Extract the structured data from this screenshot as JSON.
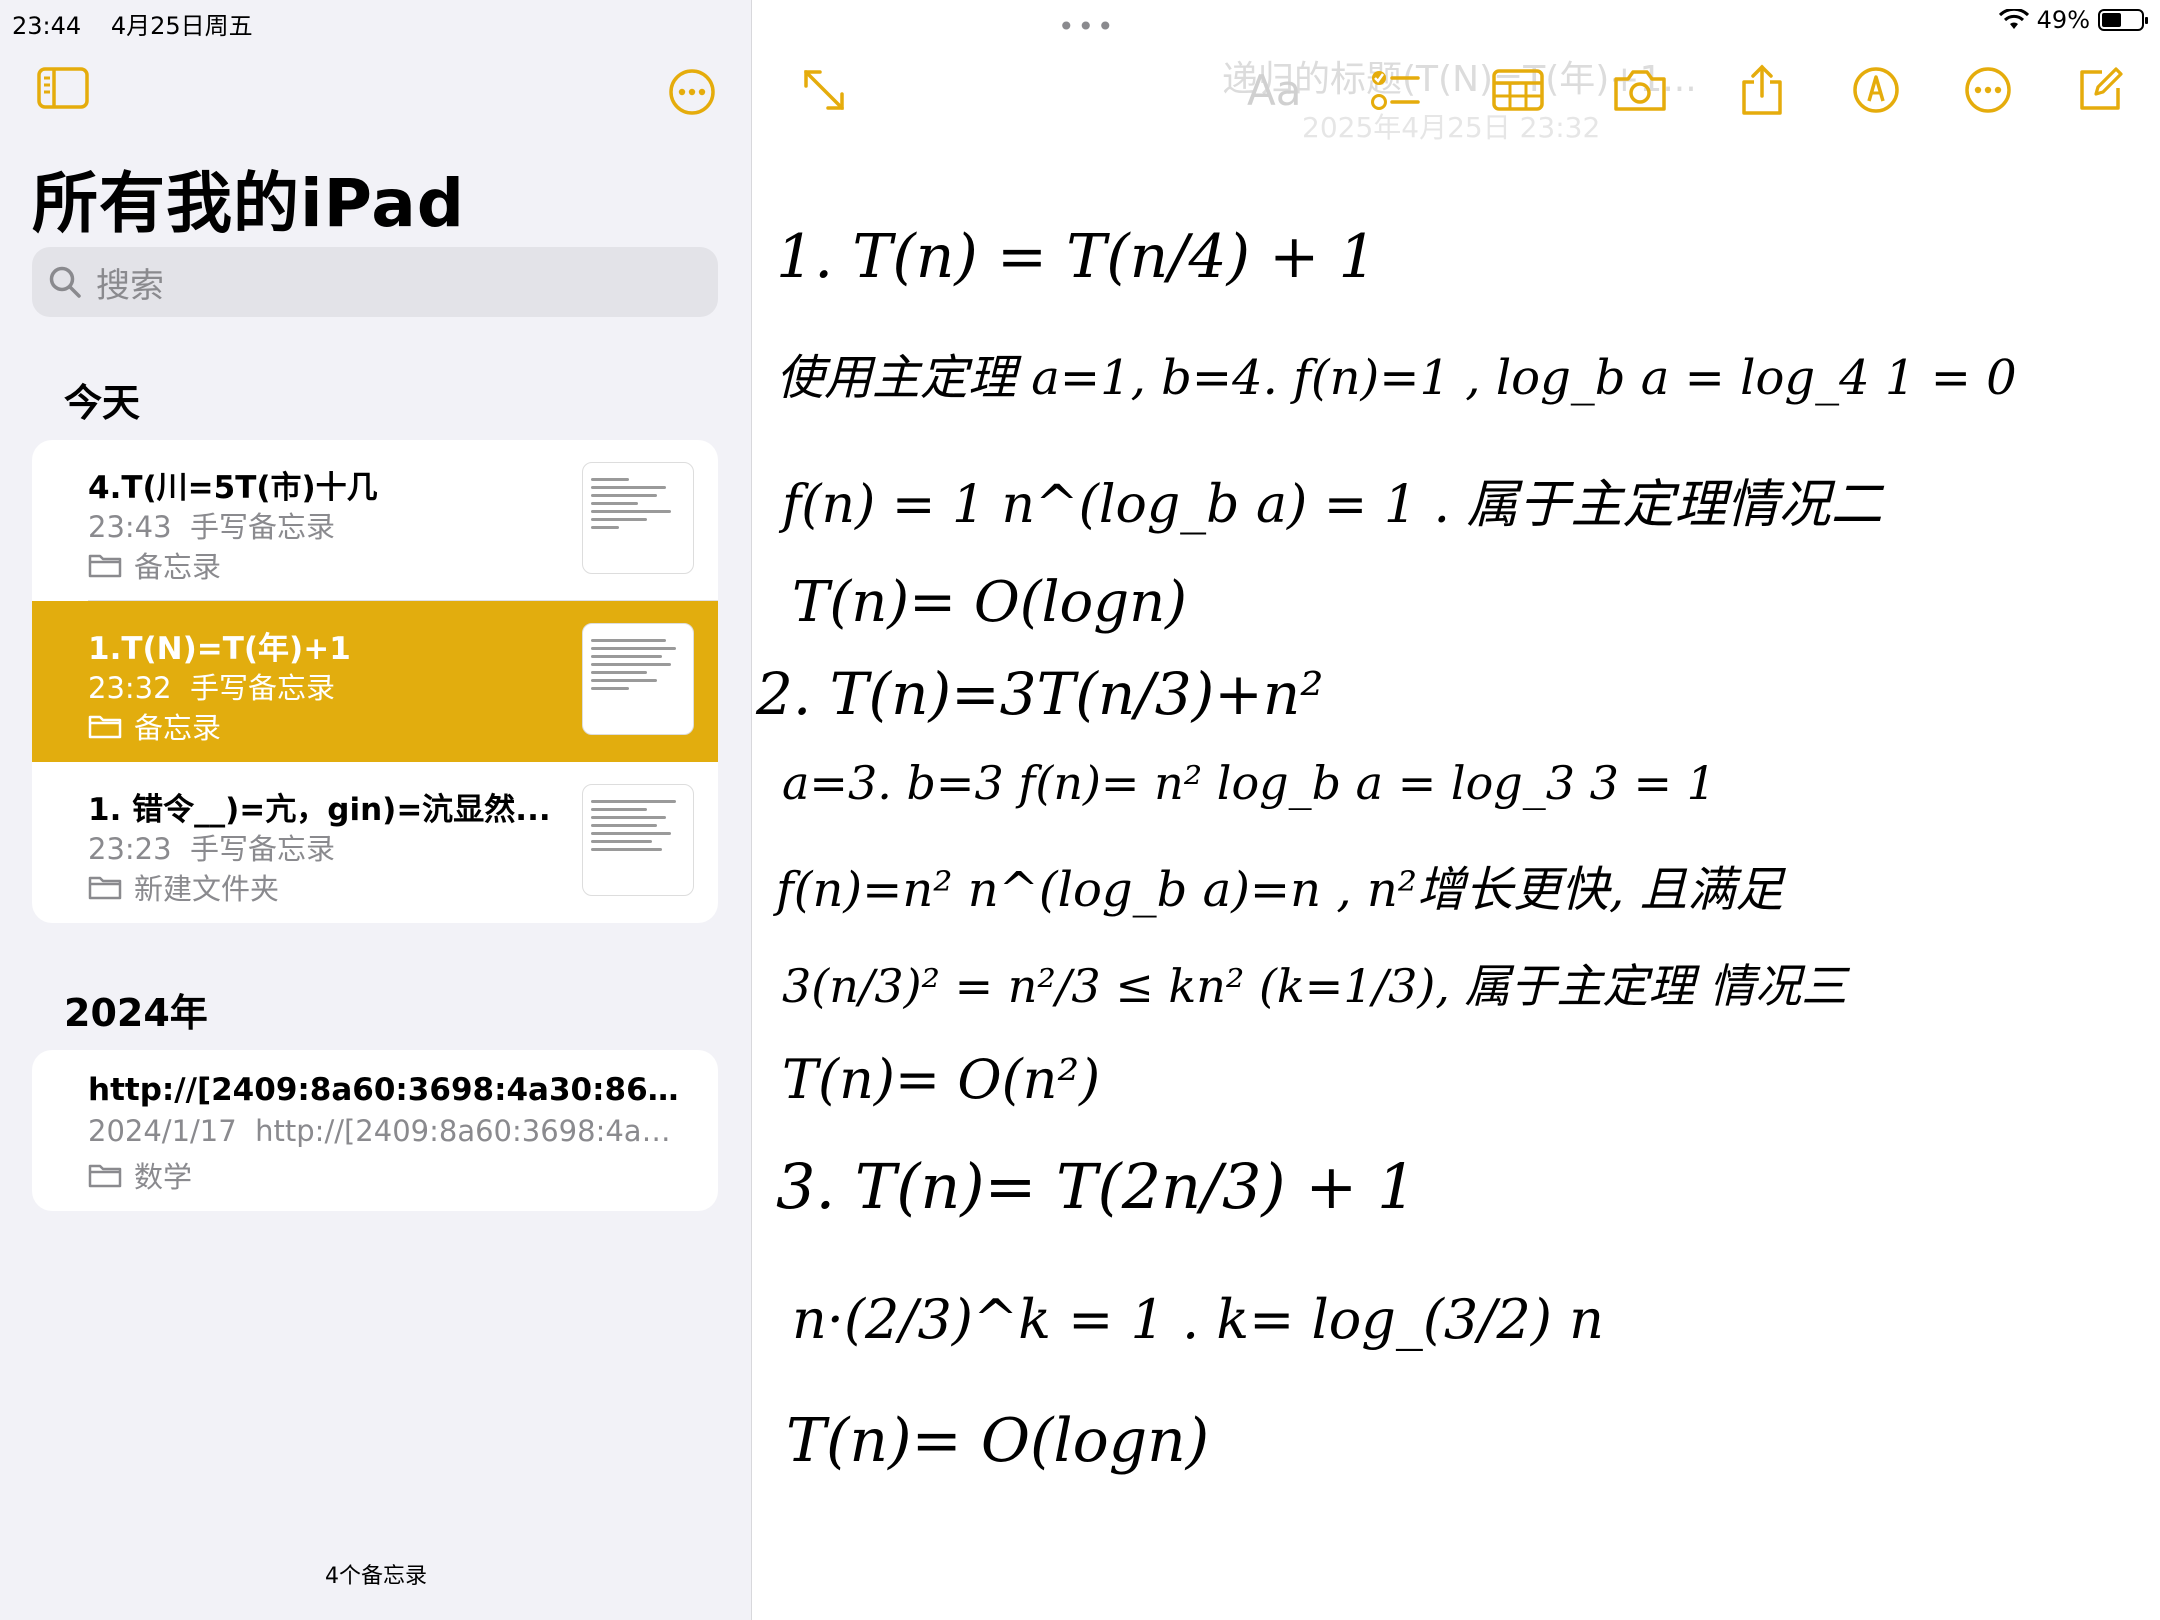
{
  "status": {
    "time": "23:44",
    "date": "4月25日周五",
    "battery": "49%"
  },
  "sidebar": {
    "title": "所有我的iPad",
    "search_placeholder": "搜索",
    "sections": [
      {
        "header": "今天"
      },
      {
        "header": "2024年"
      }
    ],
    "notes": [
      {
        "title": "4.T(川=5T(市)十几",
        "time": "23:43",
        "kind": "手写备忘录",
        "folder": "备忘录"
      },
      {
        "title": "1.T(N)=T(年)+1",
        "time": "23:32",
        "kind": "手写备忘录",
        "folder": "备忘录"
      },
      {
        "title": "1. 错令__)=亢，gin)=沆显然...",
        "time": "23:23",
        "kind": "手写备忘录",
        "folder": "新建文件夹"
      },
      {
        "title": "http://[2409:8a60:3698:4a30:864...",
        "time": "2024/1/17",
        "kind": "http://[2409:8a60:3698:4a30:...",
        "folder": "数学"
      }
    ],
    "footer": "4个备忘录"
  },
  "editor": {
    "faded_title": "递归的标题(T(N)=T(年)+1...",
    "faded_date": "2025年4月25日 23:32",
    "aa_label": "Aa",
    "handwriting": [
      "1. T(n) = T(n/4) + 1",
      "使用主定理 a=1, b=4. f(n)=1 , log_b a = log_4 1 = 0",
      "f(n) = 1   n^(log_b a) = 1 . 属于主定理情况二",
      "T(n)= O(logn)",
      "2. T(n)=3T(n/3)+n²",
      "a=3. b=3  f(n)= n²   log_b a = log_3 3 = 1",
      "f(n)=n²   n^(log_b a)=n , n²增长更快, 且满足",
      "3(n/3)² = n²/3 ≤ kn² (k=1/3), 属于主定理 情况三",
      "T(n)= O(n²)",
      "3. T(n)= T(2n/3) + 1",
      "n·(2/3)^k = 1 . k= log_(3/2) n",
      "T(n)= O(logn)"
    ]
  },
  "colors": {
    "accent": "#e2ad0e",
    "sidebar_bg": "#f2f2f7"
  },
  "icons": [
    "sidebar-toggle-icon",
    "more-icon",
    "search-icon",
    "folder-icon",
    "expand-icon",
    "checklist-icon",
    "table-icon",
    "camera-icon",
    "share-icon",
    "markup-icon",
    "compose-icon",
    "wifi-icon",
    "battery-icon"
  ]
}
